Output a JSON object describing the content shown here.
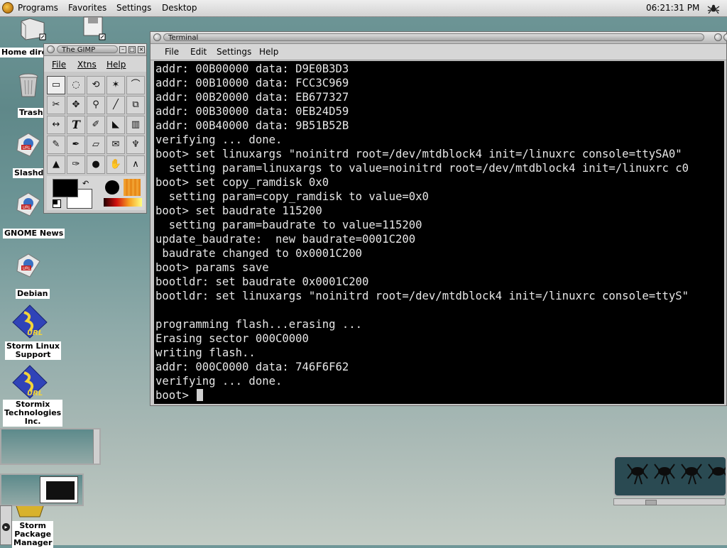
{
  "panel": {
    "menus": [
      "Programs",
      "Favorites",
      "Settings",
      "Desktop"
    ],
    "clock": "06:21:31 PM"
  },
  "desktop": {
    "icons": [
      {
        "label": "Home direct"
      },
      {
        "label": "Trash"
      },
      {
        "label": "Slashdo"
      },
      {
        "label": "GNOME News"
      },
      {
        "label": "Debian"
      },
      {
        "label": "Storm Linux\nSupport"
      },
      {
        "label": "Stormix\nTechnologies\nInc."
      },
      {
        "label": "Storm\nPackage\nManager"
      }
    ],
    "url_badge": "URL"
  },
  "gimp": {
    "title": "The GIMP",
    "menus": [
      "File",
      "Xtns",
      "Help"
    ],
    "tools": [
      "rect-select",
      "ellipse-select",
      "free-select",
      "fuzzy-select",
      "bezier-select",
      "intelligent-scissors",
      "move",
      "magnify",
      "crop",
      "transform",
      "flip",
      "text",
      "color-picker",
      "bucket-fill",
      "blend",
      "pencil",
      "paintbrush",
      "eraser",
      "airbrush",
      "clone",
      "convolve",
      "ink",
      "dodge-burn",
      "smudge",
      "measure"
    ],
    "text_tool_glyph": "T"
  },
  "terminal": {
    "title": "Terminal",
    "menus": [
      "File",
      "Edit",
      "Settings",
      "Help"
    ],
    "lines": [
      "addr: 00B00000 data: D9E0B3D3",
      "addr: 00B10000 data: FCC3C969",
      "addr: 00B20000 data: EB677327",
      "addr: 00B30000 data: 0EB24D59",
      "addr: 00B40000 data: 9B51B52B",
      "verifying ... done.",
      "boot> set linuxargs \"noinitrd root=/dev/mtdblock4 init=/linuxrc console=ttySA0\"",
      "  setting param=linuxargs to value=noinitrd root=/dev/mtdblock4 init=/linuxrc c0",
      "boot> set copy_ramdisk 0x0",
      "  setting param=copy_ramdisk to value=0x0",
      "boot> set baudrate 115200",
      "  setting param=baudrate to value=115200",
      "update_baudrate:  new baudrate=0001C200",
      " baudrate changed to 0x0001C200",
      "boot> params save",
      "bootldr: set baudrate 0x0001C200",
      "bootldr: set linuxargs \"noinitrd root=/dev/mtdblock4 init=/linuxrc console=ttyS\"",
      "",
      "programming flash...erasing ...",
      "Erasing sector 000C0000",
      "writing flash..",
      "addr: 000C0000 data: 746F6F62",
      "verifying ... done."
    ],
    "prompt": "boot> "
  },
  "colors": {
    "terminal_bg": "#000000",
    "terminal_fg": "#e6e6e6",
    "panel_bg": "#dcdcdc",
    "desktop": "#6f9798"
  }
}
